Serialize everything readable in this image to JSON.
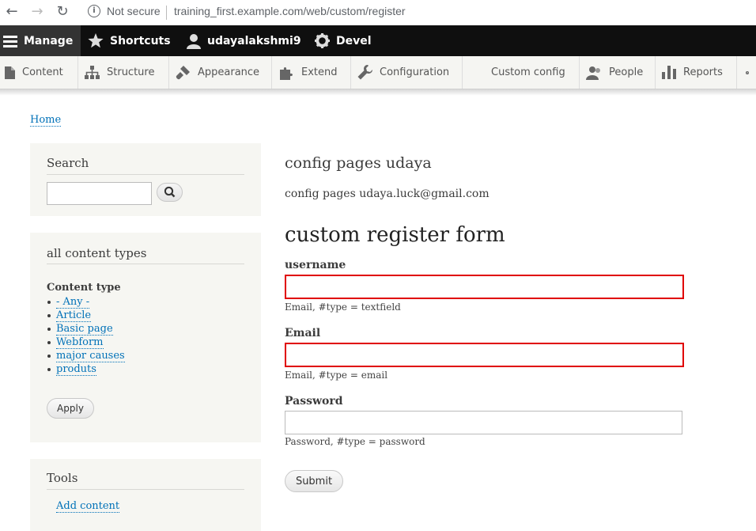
{
  "browser": {
    "security_text": "Not secure",
    "url": "training_first.example.com/web/custom/register"
  },
  "toolbar": {
    "manage": "Manage",
    "shortcuts": "Shortcuts",
    "user": "udayalakshmi9",
    "devel": "Devel"
  },
  "tray": {
    "items": [
      "Content",
      "Structure",
      "Appearance",
      "Extend",
      "Configuration",
      "Custom config",
      "People",
      "Reports"
    ]
  },
  "breadcrumb": {
    "home": "Home"
  },
  "sidebar": {
    "search": {
      "title": "Search"
    },
    "filter": {
      "title": "all content types",
      "label": "Content type",
      "options": [
        "- Any -",
        "Article",
        "Basic page",
        "Webform",
        "major causes",
        "produts"
      ],
      "apply": "Apply"
    },
    "tools": {
      "title": "Tools",
      "link": "Add content"
    }
  },
  "main": {
    "config_title": "config pages udaya",
    "config_line": "config pages udaya.luck@gmail.com",
    "form_title": "custom register form",
    "fields": [
      {
        "label": "username",
        "description": "Email, #type = textfield",
        "error": true
      },
      {
        "label": "Email",
        "description": "Email, #type = email",
        "error": true
      },
      {
        "label": "Password",
        "description": "Password, #type = password",
        "error": false
      }
    ],
    "submit": "Submit"
  },
  "colors": {
    "link": "#0071b8",
    "error_border": "#e00000",
    "toolbar_bg": "#0f0f0f",
    "tray_bg": "#f5f5f2"
  }
}
